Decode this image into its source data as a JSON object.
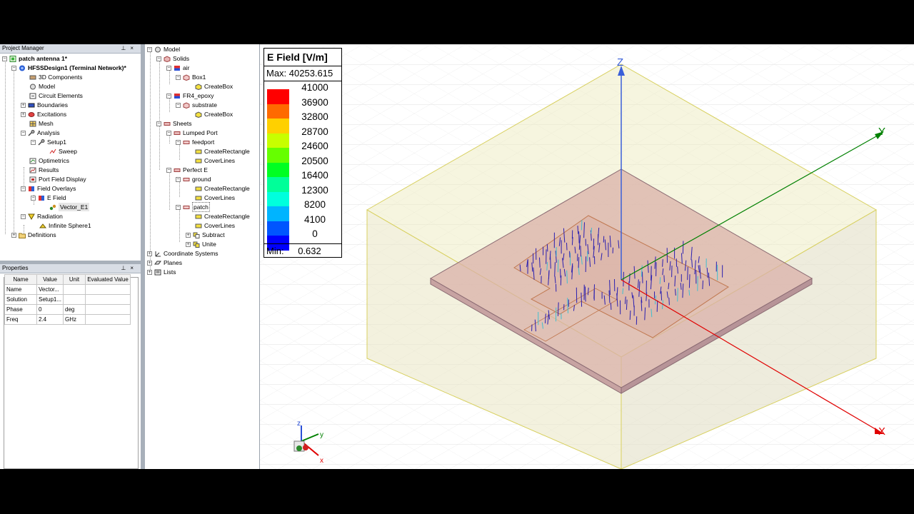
{
  "project_manager": {
    "title": "Project Manager",
    "items": [
      {
        "label": "patch antenna 1*"
      },
      {
        "label": "HFSSDesign1 (Terminal Network)*"
      },
      {
        "label": "3D Components"
      },
      {
        "label": "Model"
      },
      {
        "label": "Circuit Elements"
      },
      {
        "label": "Boundaries"
      },
      {
        "label": "Excitations"
      },
      {
        "label": "Mesh"
      },
      {
        "label": "Analysis"
      },
      {
        "label": "Setup1"
      },
      {
        "label": "Sweep"
      },
      {
        "label": "Optimetrics"
      },
      {
        "label": "Results"
      },
      {
        "label": "Port Field Display"
      },
      {
        "label": "Field Overlays"
      },
      {
        "label": "E Field"
      },
      {
        "label": "Vector_E1"
      },
      {
        "label": "Radiation"
      },
      {
        "label": "Infinite Sphere1"
      },
      {
        "label": "Definitions"
      }
    ]
  },
  "properties": {
    "title": "Properties",
    "headers": [
      "Name",
      "Value",
      "Unit",
      "Evaluated Value"
    ],
    "rows": [
      [
        "Name",
        "Vector...",
        "",
        ""
      ],
      [
        "Solution",
        "Setup1...",
        "",
        ""
      ],
      [
        "Phase",
        "0",
        "deg",
        ""
      ],
      [
        "Freq",
        "2.4",
        "GHz",
        ""
      ]
    ]
  },
  "model_tree": {
    "items": [
      {
        "label": "Model"
      },
      {
        "label": "Solids"
      },
      {
        "label": "air"
      },
      {
        "label": "Box1"
      },
      {
        "label": "CreateBox"
      },
      {
        "label": "FR4_epoxy"
      },
      {
        "label": "substrate"
      },
      {
        "label": "CreateBox"
      },
      {
        "label": "Sheets"
      },
      {
        "label": "Lumped Port"
      },
      {
        "label": "feedport"
      },
      {
        "label": "CreateRectangle"
      },
      {
        "label": "CoverLines"
      },
      {
        "label": "Perfect E"
      },
      {
        "label": "ground"
      },
      {
        "label": "CreateRectangle"
      },
      {
        "label": "CoverLines"
      },
      {
        "label": "patch"
      },
      {
        "label": "CreateRectangle"
      },
      {
        "label": "CoverLines"
      },
      {
        "label": "Subtract"
      },
      {
        "label": "Unite"
      },
      {
        "label": "Coordinate Systems"
      },
      {
        "label": "Planes"
      },
      {
        "label": "Lists"
      }
    ]
  },
  "legend": {
    "title": "E Field [V/m]",
    "max": "Max: 40253.615",
    "min_label": "Min:",
    "min_value": "0.632",
    "values": [
      "41000",
      "36900",
      "32800",
      "28700",
      "24600",
      "20500",
      "16400",
      "12300",
      "8200",
      "4100",
      "0"
    ],
    "colors": [
      "#ff0000",
      "#ff6a00",
      "#ffd000",
      "#c8ff00",
      "#66ff00",
      "#00ff22",
      "#00ff99",
      "#00ffdd",
      "#00b4ff",
      "#0055ff",
      "#0000ff"
    ]
  },
  "axes": {
    "z": "Z",
    "y": "Y",
    "x": "X",
    "triad_z": "z",
    "triad_y": "y",
    "triad_x": "x",
    "colors": {
      "x": "#e00000",
      "y": "#008000",
      "z": "#3a5fd9"
    }
  }
}
